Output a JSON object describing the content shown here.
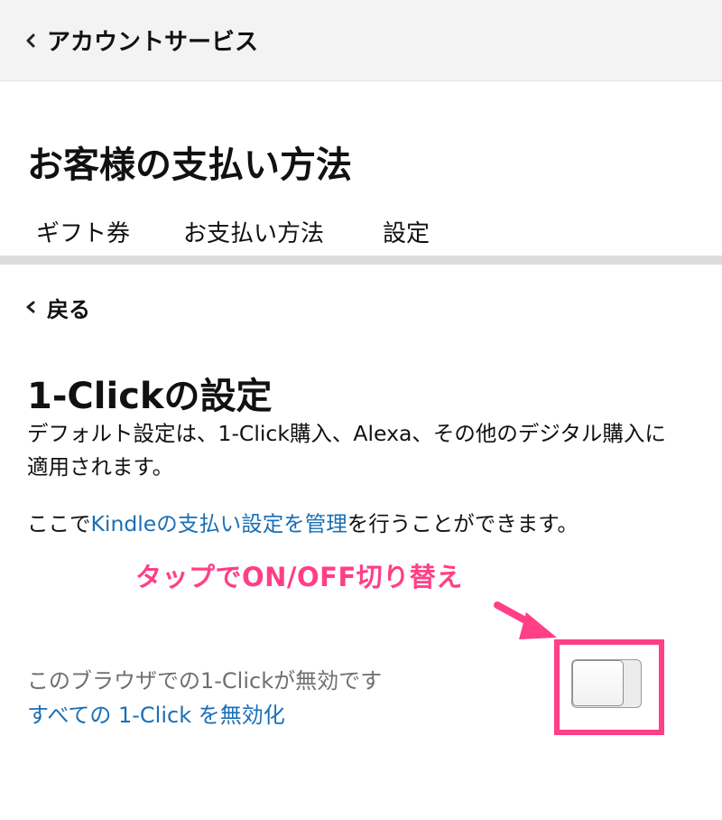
{
  "header": {
    "back_label": "アカウントサービス",
    "page_title": "お客様の支払い方法"
  },
  "tabs": [
    {
      "label": "ギフト券"
    },
    {
      "label": "お支払い方法"
    },
    {
      "label": "設定"
    }
  ],
  "back_link": {
    "label": "戻る"
  },
  "one_click": {
    "title": "1-Clickの設定",
    "description": "デフォルト設定は、1-Click購入、Alexa、その他のデジタル購入に適用されます。",
    "manage_prefix": "ここで",
    "manage_link": "Kindleの支払い設定を管理",
    "manage_suffix": "を行うことができます。",
    "status_text": "このブラウザでの1-Clickが無効です",
    "disable_all_link": "すべての 1-Click を無効化",
    "toggle_state": "off"
  },
  "annotation": {
    "text": "タップでON/OFF切り替え",
    "color": "#ff3f86"
  },
  "colors": {
    "link": "#1a6fb5",
    "accent": "#ff3f86",
    "header_bg": "#f3f3f3"
  },
  "icons": {
    "back_chevron": "chevron-left-icon",
    "arrow": "arrow-icon"
  }
}
